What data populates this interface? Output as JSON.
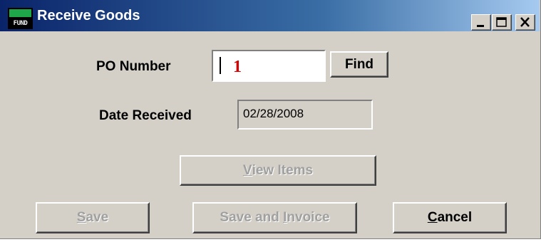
{
  "window": {
    "title": "Receive Goods",
    "icon_text": "FUND",
    "icon": "fund-app-icon",
    "controls": [
      "minimize-icon",
      "maximize-icon",
      "close-icon"
    ]
  },
  "form": {
    "po_number_label": "PO Number",
    "po_number_value": "1",
    "date_received_label": "Date Received",
    "date_received_value": "02/28/2008"
  },
  "buttons": {
    "find": "Find",
    "view_items": {
      "hotkey": "V",
      "rest": "iew Items",
      "enabled": false
    },
    "save": {
      "hotkey": "S",
      "rest": "ave",
      "enabled": false
    },
    "save_and_invoice": {
      "prefix": "Save and ",
      "hotkey": "I",
      "rest": "nvoice",
      "enabled": false
    },
    "cancel": {
      "hotkey": "C",
      "rest": "ancel",
      "enabled": true
    }
  },
  "colors": {
    "title_gradient_start": "#0a246a",
    "title_gradient_end": "#a6caf0",
    "po_value": "#d40000",
    "face": "#d4d0c8"
  }
}
